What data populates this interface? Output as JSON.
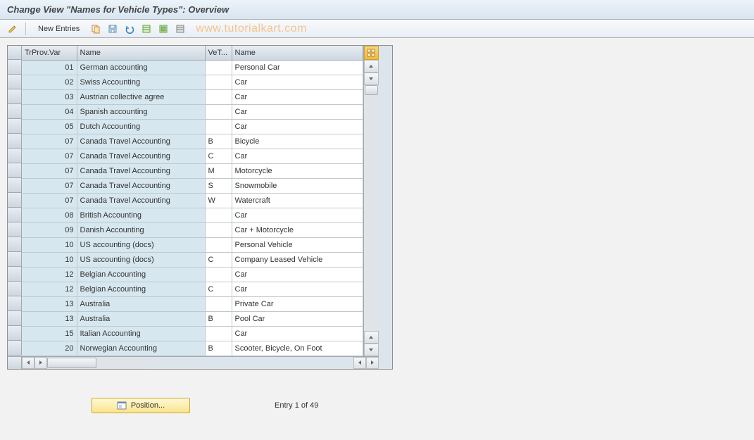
{
  "header": {
    "title": "Change View \"Names for Vehicle Types\": Overview"
  },
  "toolbar": {
    "new_entries_label": "New Entries",
    "watermark": "www.tutorialkart.com"
  },
  "table": {
    "columns": {
      "trprov": "TrProv.Var",
      "name1": "Name",
      "vet": "VeT...",
      "name2": "Name"
    },
    "rows": [
      {
        "trprov": "01",
        "name1": "German accounting",
        "vet": "",
        "name2": "Personal Car"
      },
      {
        "trprov": "02",
        "name1": "Swiss Accounting",
        "vet": "",
        "name2": "Car"
      },
      {
        "trprov": "03",
        "name1": "Austrian collective agree",
        "vet": "",
        "name2": "Car"
      },
      {
        "trprov": "04",
        "name1": "Spanish accounting",
        "vet": "",
        "name2": "Car"
      },
      {
        "trprov": "05",
        "name1": "Dutch Accounting",
        "vet": "",
        "name2": "Car"
      },
      {
        "trprov": "07",
        "name1": "Canada Travel Accounting",
        "vet": "B",
        "name2": "Bicycle"
      },
      {
        "trprov": "07",
        "name1": "Canada Travel Accounting",
        "vet": "C",
        "name2": "Car"
      },
      {
        "trprov": "07",
        "name1": "Canada Travel Accounting",
        "vet": "M",
        "name2": "Motorcycle"
      },
      {
        "trprov": "07",
        "name1": "Canada Travel Accounting",
        "vet": "S",
        "name2": "Snowmobile"
      },
      {
        "trprov": "07",
        "name1": "Canada Travel Accounting",
        "vet": "W",
        "name2": "Watercraft"
      },
      {
        "trprov": "08",
        "name1": "British Accounting",
        "vet": "",
        "name2": "Car"
      },
      {
        "trprov": "09",
        "name1": "Danish Accounting",
        "vet": "",
        "name2": "Car + Motorcycle"
      },
      {
        "trprov": "10",
        "name1": "US accounting (docs)",
        "vet": "",
        "name2": "Personal Vehicle"
      },
      {
        "trprov": "10",
        "name1": "US accounting (docs)",
        "vet": "C",
        "name2": "Company Leased Vehicle"
      },
      {
        "trprov": "12",
        "name1": "Belgian Accounting",
        "vet": "",
        "name2": "Car"
      },
      {
        "trprov": "12",
        "name1": "Belgian Accounting",
        "vet": "C",
        "name2": "Car"
      },
      {
        "trprov": "13",
        "name1": "Australia",
        "vet": "",
        "name2": "Private Car"
      },
      {
        "trprov": "13",
        "name1": "Australia",
        "vet": "B",
        "name2": "Pool Car"
      },
      {
        "trprov": "15",
        "name1": "Italian Accounting",
        "vet": "",
        "name2": "Car"
      },
      {
        "trprov": "20",
        "name1": "Norwegian Accounting",
        "vet": "B",
        "name2": "Scooter, Bicycle, On Foot"
      }
    ]
  },
  "footer": {
    "position_label": "Position...",
    "entry_label": "Entry 1 of 49"
  },
  "icons": {
    "pencil": "pencil-icon",
    "copy": "copy-icon",
    "save": "save-icon",
    "undo": "undo-icon",
    "select_all": "select-all-icon",
    "select_block": "select-block-icon",
    "deselect": "deselect-icon",
    "table_settings": "table-settings-icon"
  }
}
